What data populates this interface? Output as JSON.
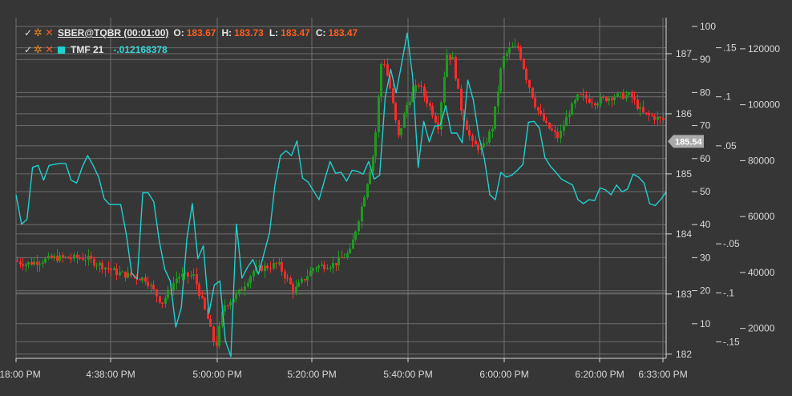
{
  "legend": {
    "security": {
      "title": "SBER@TQBR (00:01:00)",
      "o_label": "O:",
      "o_value": "183.67",
      "h_label": "H:",
      "h_value": "183.73",
      "l_label": "L:",
      "l_value": "183.47",
      "c_label": "C:",
      "c_value": "183.47"
    },
    "indicator": {
      "title": "TMF 21",
      "value": "-.012168378",
      "color": "#1fd0d0"
    },
    "icons": {
      "check": "check-icon",
      "settings": "gear-icon",
      "remove": "close-icon"
    }
  },
  "chart_data": {
    "type": "candlestick",
    "x_ticks": [
      "4:18:00 PM",
      "4:38:00 PM",
      "5:00:00 PM",
      "5:20:00 PM",
      "5:40:00 PM",
      "6:00:00 PM",
      "6:20:00 PM",
      "6:33:00 PM"
    ],
    "price_axis": {
      "ticks": [
        "182",
        "183",
        "184",
        "185",
        "186",
        "187"
      ],
      "range": [
        181.93,
        187.6
      ],
      "current": "185.54"
    },
    "percent_axis": {
      "ticks": [
        "10",
        "20",
        "30",
        "40",
        "50",
        "60",
        "70",
        "80",
        "90",
        "100"
      ],
      "range": [
        0,
        100
      ]
    },
    "tmf_axis": {
      "ticks": [
        "-.15",
        "-.1",
        "-.05",
        ".05",
        ".1",
        ".15"
      ],
      "range": [
        -0.166,
        0.166
      ]
    },
    "volume_axis": {
      "ticks": [
        "20000",
        "40000",
        "60000",
        "80000",
        "100000",
        "120000"
      ],
      "range": [
        7000,
        128000
      ]
    },
    "tmf_series": {
      "name": "TMF 21",
      "color": "#1fd0d0",
      "values": [
        -0.0,
        -0.03,
        -0.025,
        0.028,
        0.03,
        0.015,
        0.03,
        0.031,
        0.032,
        0.032,
        0.015,
        0.012,
        0.028,
        0.04,
        0.03,
        0.018,
        -0.004,
        -0.01,
        -0.01,
        -0.01,
        -0.04,
        -0.08,
        -0.086,
        0.002,
        0.002,
        -0.007,
        -0.047,
        -0.076,
        -0.088,
        -0.135,
        -0.115,
        -0.045,
        -0.009,
        -0.065,
        -0.052,
        -0.121,
        -0.092,
        -0.088,
        -0.149,
        -0.165,
        -0.03,
        -0.085,
        -0.074,
        -0.066,
        -0.081,
        -0.06,
        -0.039,
        0.01,
        0.04,
        0.045,
        0.04,
        0.055,
        0.017,
        0.013,
        0.004,
        -0.005,
        0.015,
        0.034,
        0.022,
        0.023,
        0.014,
        0.025,
        0.024,
        0.021,
        0.034,
        0.016,
        0.02,
        0.099,
        0.128,
        0.104,
        0.134,
        0.165,
        0.12,
        0.028,
        0.075,
        0.054,
        0.07,
        0.071,
        0.091,
        0.063,
        0.063,
        0.053,
        0.117,
        0.097,
        0.06,
        0.037,
        0.0,
        -0.005,
        0.023,
        0.018,
        0.02,
        0.025,
        0.031,
        0.074,
        0.075,
        0.068,
        0.038,
        0.029,
        0.023,
        0.016,
        0.013,
        0.01,
        -0.005,
        -0.009,
        -0.005,
        -0.006,
        0.007,
        0.005,
        0.0,
        0.01,
        0.003,
        0.006,
        0.021,
        0.018,
        0.012,
        -0.009,
        -0.011,
        -0.005,
        0.003
      ]
    }
  }
}
